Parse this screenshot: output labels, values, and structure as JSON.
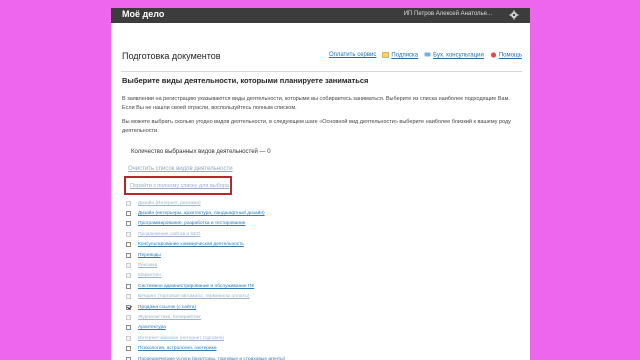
{
  "app": {
    "logo": "Моё дело",
    "user": "ИП Петров Алексей Анатолье...",
    "gear_icon": "gear-icon"
  },
  "header": {
    "title": "Подготовка документов",
    "links": {
      "pay": "Оплатить сервис",
      "subscription": "Подписка",
      "consult": "Бух. консультации",
      "help": "Помощь"
    }
  },
  "main": {
    "heading": "Выберите виды деятельности, которыми планируете заниматься",
    "paragraph1": "В заявлении на регистрацию указываются виды деятельности, которыми вы собираетесь заниматься. Выберите из списка наиболее подходящие Вам. Если Вы не нашли своей отрасли, воспользуйтесь полным списком.",
    "paragraph2": "Вы можете выбрать сколько угодно видов деятельности, в следующем шаге «Основной вид деятельности» выберите наиболее близкий к вашему роду деятельности.",
    "count_label": "Количество выбранных видов деятельностей — 0",
    "clear_link": "Очистить список видов деятельности",
    "full_list_link": "Перейти к полному списку для выбора",
    "activities": [
      {
        "label": "Дизайн (Интернет, реклама)",
        "checked": false,
        "disabled": true
      },
      {
        "label": "Дизайн (интерьеры, архитектура, ландшафтный дизайн)",
        "checked": false,
        "disabled": false
      },
      {
        "label": "Программирование, разработка и тестирование",
        "checked": false,
        "disabled": false
      },
      {
        "label": "Продвижение сайтов и SEO",
        "checked": false,
        "disabled": true
      },
      {
        "label": "Консультирование коммерческая деятельность",
        "checked": false,
        "disabled": false
      },
      {
        "label": "Переводы",
        "checked": false,
        "disabled": false
      },
      {
        "label": "Реклама",
        "checked": false,
        "disabled": true
      },
      {
        "label": "Маркетинг",
        "checked": false,
        "disabled": true
      },
      {
        "label": "Системное администрирование и обслуживание ПК",
        "checked": false,
        "disabled": false
      },
      {
        "label": "Вендинг (торговые автоматы, терминалы оплаты)",
        "checked": false,
        "disabled": true
      },
      {
        "label": "Продажа ссылок (с сайта)",
        "checked": true,
        "disabled": false
      },
      {
        "label": "Журналистика, Копирайтинг",
        "checked": false,
        "disabled": true
      },
      {
        "label": "Архитектура",
        "checked": false,
        "disabled": false
      },
      {
        "label": "Интернет-магазин (интернет торговля)",
        "checked": false,
        "disabled": true
      },
      {
        "label": "Психология, астрология, эзотерика",
        "checked": false,
        "disabled": false
      },
      {
        "label": "Посреднические услуги (риэлторы, торговые и страховые агенты)",
        "checked": false,
        "disabled": false
      }
    ]
  }
}
